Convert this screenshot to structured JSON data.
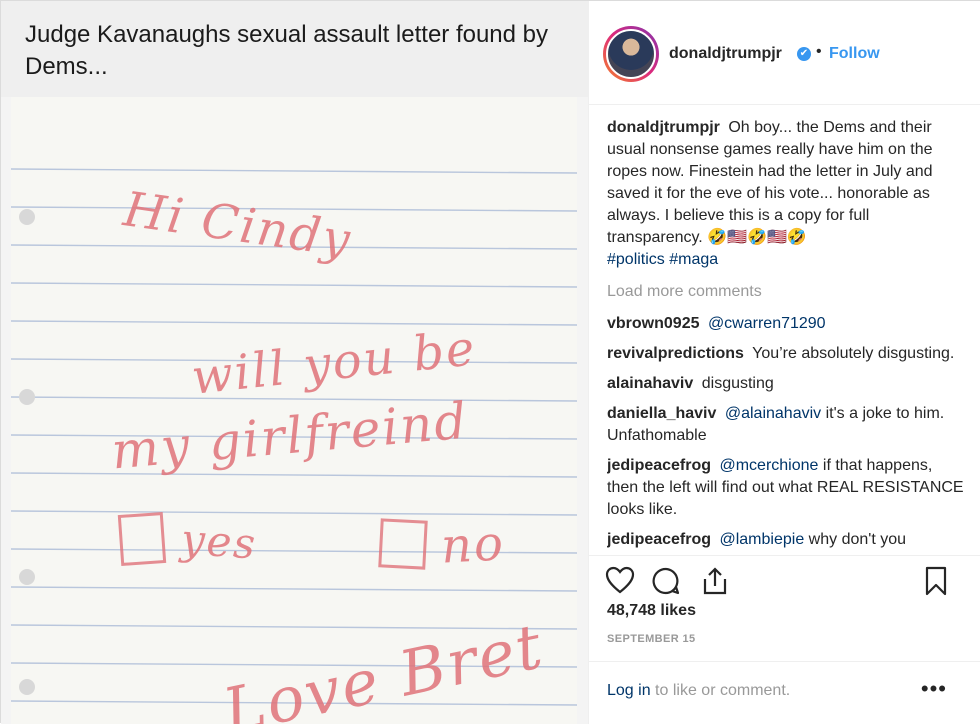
{
  "media": {
    "caption": "Judge Kavanaughs sexual assault letter found by Dems...",
    "note_lines": [
      "Hi Cindy",
      "will you be",
      "my girlfreind",
      "yes",
      "no",
      "Love Bret"
    ]
  },
  "header": {
    "username": "donaldjtrumpjr",
    "verified_icon": "✔",
    "separator": "•",
    "follow_label": "Follow"
  },
  "caption": {
    "username": "donaldjtrumpjr",
    "text": "Oh boy... the Dems and their usual nonsense games really have him on the ropes now. Finestein had the letter in July and saved it for the eve of his vote... honorable as always. I believe this is a copy for full transparency. 🤣🇺🇸🤣🇺🇸🤣",
    "hashtags": "#politics #maga"
  },
  "load_more": "Load more comments",
  "comments": [
    {
      "user": "vbrown0925",
      "mention": "@cwarren71290",
      "text": ""
    },
    {
      "user": "revivalpredictions",
      "mention": "",
      "text": "You’re absolutely disgusting."
    },
    {
      "user": "alainahaviv",
      "mention": "",
      "text": "disgusting"
    },
    {
      "user": "daniella_haviv",
      "mention": "@alainahaviv",
      "text": "it's a joke to him. Unfathomable"
    },
    {
      "user": "jedipeacefrog",
      "mention": "@mcerchione",
      "text": "if that happens, then the left will find out what REAL RESISTANCE looks like."
    },
    {
      "user": "jedipeacefrog",
      "mention": "@lambiepie",
      "text": "why don't you"
    }
  ],
  "actions": {
    "icons": [
      "heart-icon",
      "comment-icon",
      "share-icon",
      "bookmark-icon"
    ]
  },
  "likes": "48,748 likes",
  "date": "SEPTEMBER 15",
  "footer": {
    "login_link": "Log in",
    "login_rest": "to like or comment.",
    "more": "•••"
  },
  "colors": {
    "accent": "#3897f0",
    "link": "#003569",
    "muted": "#999999",
    "ink": "#e0737a"
  }
}
